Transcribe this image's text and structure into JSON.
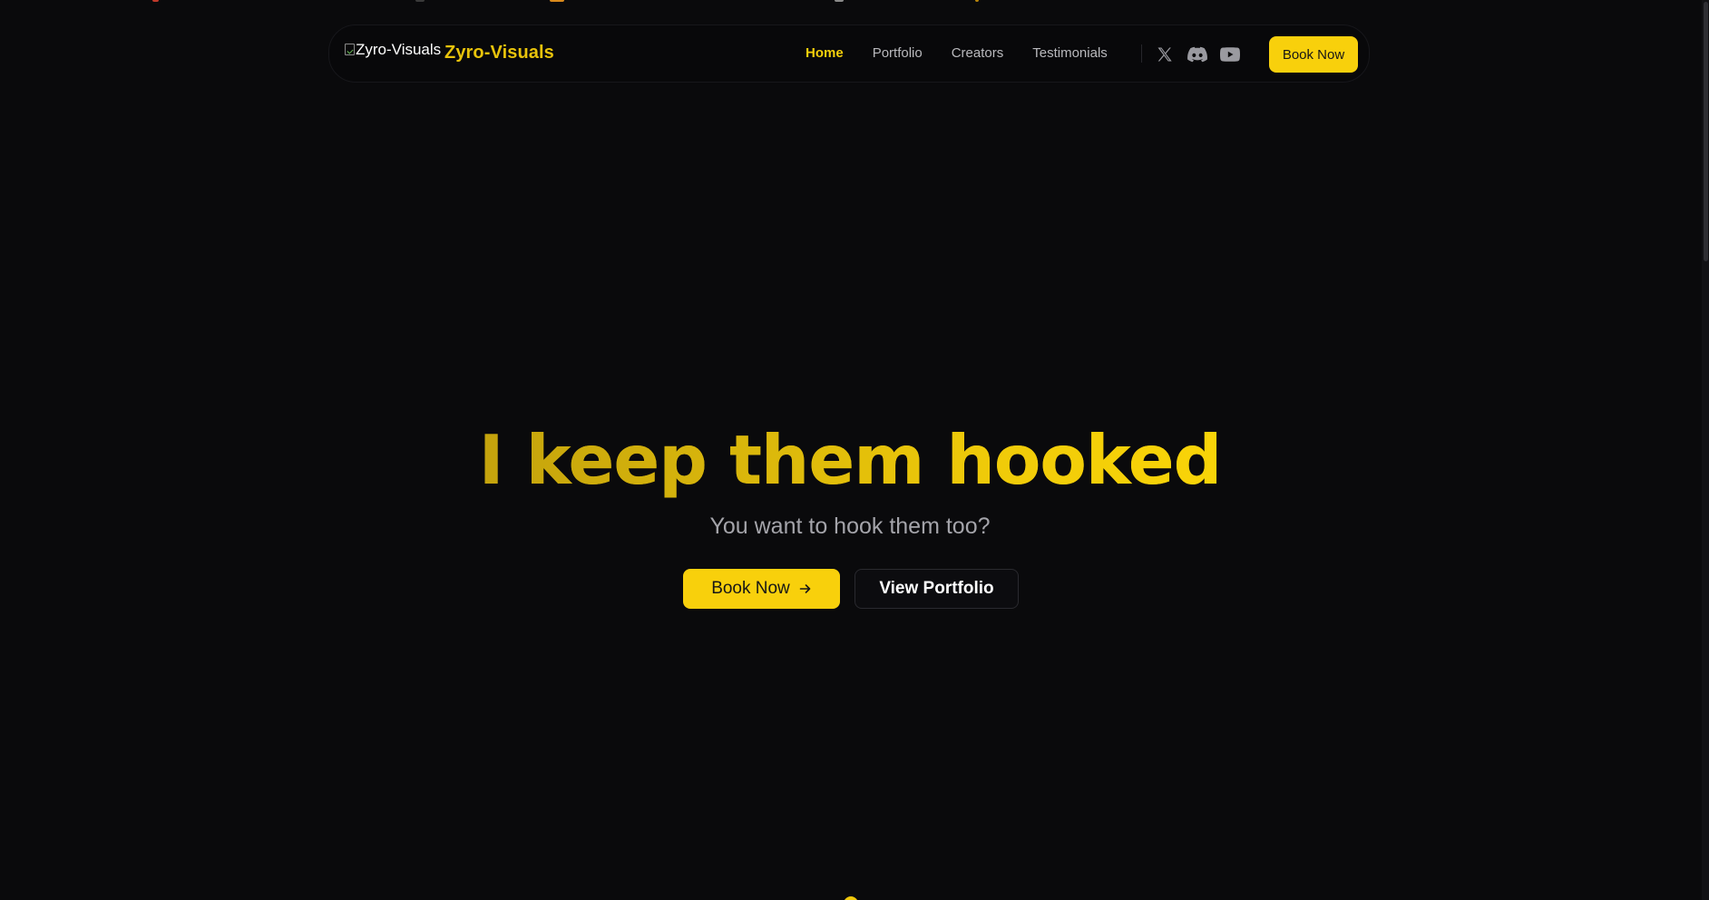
{
  "brand": {
    "logo_alt": "Zyro-Visuals",
    "name": "Zyro-Visuals"
  },
  "nav": {
    "links": [
      {
        "label": "Home",
        "active": true
      },
      {
        "label": "Portfolio",
        "active": false
      },
      {
        "label": "Creators",
        "active": false
      },
      {
        "label": "Testimonials",
        "active": false
      }
    ],
    "social_icons": [
      "x-twitter-icon",
      "discord-icon",
      "youtube-icon"
    ],
    "cta_label": "Book Now"
  },
  "hero": {
    "title": "I keep them hooked",
    "subtitle": "You want to hook them too?",
    "primary_button": "Book Now",
    "primary_button_icon": "arrow-right-icon",
    "secondary_button": "View Portfolio"
  },
  "colors": {
    "background": "#0a0a0c",
    "accent": "#f8d00c",
    "muted_text": "#a4a4aa"
  }
}
